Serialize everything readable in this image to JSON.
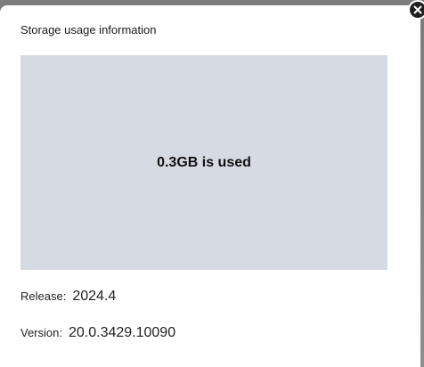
{
  "dialog": {
    "title": "Storage usage information",
    "usage_text": "0.3GB is used",
    "release": {
      "label": "Release:",
      "value": "2024.4"
    },
    "version": {
      "label": "Version:",
      "value": "20.0.3429.10090"
    },
    "close_icon": "close-icon"
  },
  "colors": {
    "panel_bg": "#d6dae2",
    "close_bg": "#1f1f1f"
  }
}
